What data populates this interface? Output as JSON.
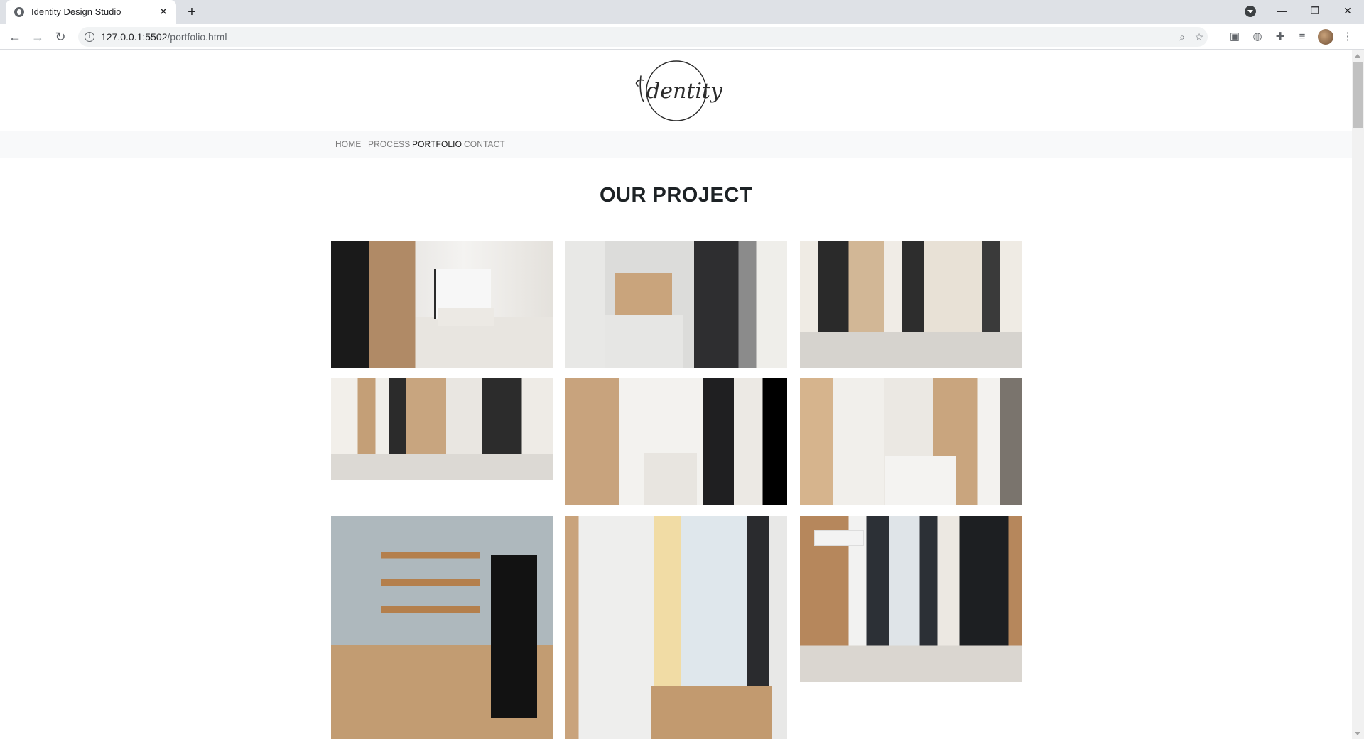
{
  "browser": {
    "tab_title": "Identity Design Studio",
    "url_host": "127.0.0.1:5502",
    "url_path": "/portfolio.html"
  },
  "brand": {
    "logo_text": "Identity"
  },
  "nav": {
    "items": [
      {
        "label": "HOME",
        "active": false
      },
      {
        "label": "PROCESS",
        "active": false
      },
      {
        "label": "PORTFOLIO",
        "active": true
      },
      {
        "label": "CONTACT",
        "active": false
      }
    ]
  },
  "main": {
    "heading": "OUR PROJECT"
  },
  "portfolio": {
    "photos": [
      {
        "name": "living-room-render-1"
      },
      {
        "name": "bedroom-render-1"
      },
      {
        "name": "entry-render-1"
      },
      {
        "name": "living-kitchen-render"
      },
      {
        "name": "kitchen-render"
      },
      {
        "name": "bedroom-render-2"
      },
      {
        "name": "bedroom-photo-1"
      },
      {
        "name": "bedroom-photo-2"
      },
      {
        "name": "living-room-photo"
      }
    ]
  }
}
